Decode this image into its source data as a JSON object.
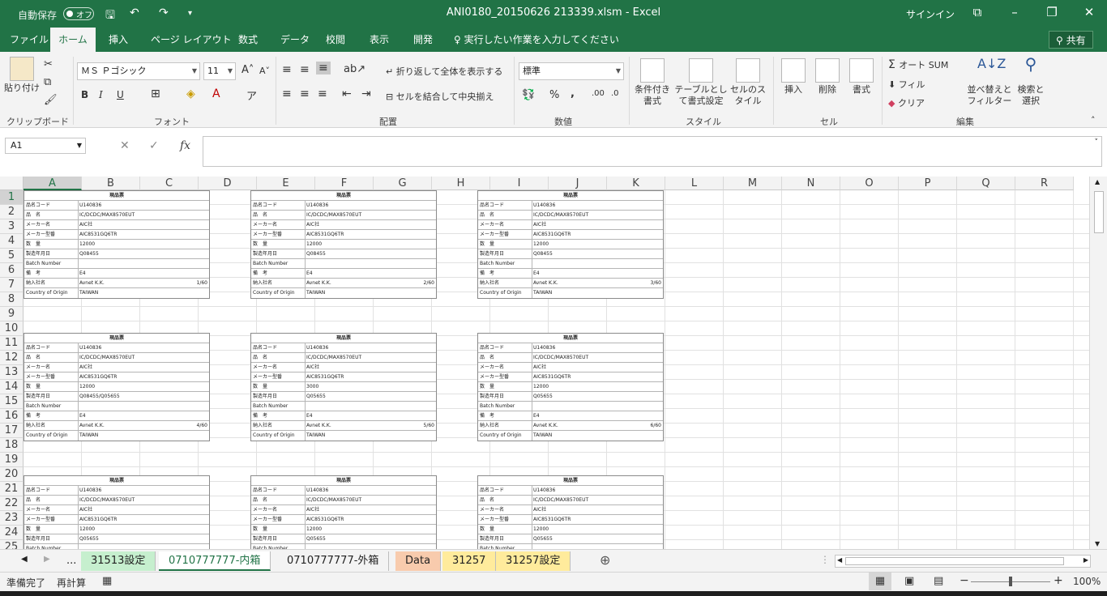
{
  "title_bar": {
    "autosave_label": "自動保存",
    "autosave_state": "オフ",
    "document_title": "ANI0180_20150626 213339.xlsm  -  Excel",
    "signin": "サインイン"
  },
  "ribbon_tabs": [
    "ファイル",
    "ホーム",
    "挿入",
    "ページ レイアウト",
    "数式",
    "データ",
    "校閲",
    "表示",
    "開発"
  ],
  "tell_me": "実行したい作業を入力してください",
  "share_label": "共有",
  "ribbon": {
    "clipboard": {
      "paste": "貼り付け",
      "label": "クリップボード"
    },
    "font": {
      "name": "ＭＳ Ｐゴシック",
      "size": "11",
      "bold": "B",
      "italic": "I",
      "underline": "U",
      "label": "フォント"
    },
    "alignment": {
      "wrap": "折り返して全体を表示する",
      "merge": "セルを結合して中央揃え",
      "label": "配置"
    },
    "number": {
      "format": "標準",
      "percent": "%",
      "comma": ",",
      "label": "数値"
    },
    "styles": {
      "conditional": "条件付き書式",
      "table": "テーブルとして書式設定",
      "cell": "セルのスタイル",
      "label": "スタイル"
    },
    "cells": {
      "insert": "挿入",
      "delete": "削除",
      "format": "書式",
      "label": "セル"
    },
    "editing": {
      "autosum": "オート SUM",
      "fill": "フィル",
      "clear": "クリア",
      "sort": "並べ替えとフィルター",
      "find": "検索と選択",
      "label": "編集"
    }
  },
  "formula_bar": {
    "name_box": "A1",
    "fx": "fx",
    "value": ""
  },
  "columns": [
    "A",
    "B",
    "C",
    "D",
    "E",
    "F",
    "G",
    "H",
    "I",
    "J",
    "K",
    "L",
    "M",
    "N",
    "O",
    "P",
    "Q",
    "R"
  ],
  "rows": [
    "1",
    "2",
    "3",
    "4",
    "5",
    "6",
    "7",
    "8",
    "9",
    "10",
    "11",
    "12",
    "13",
    "14",
    "15",
    "16",
    "17",
    "18",
    "19",
    "20",
    "21",
    "22",
    "23",
    "24",
    "25"
  ],
  "card_labels": {
    "title": "現品票",
    "code": "品名コード",
    "name": "品　名",
    "maker": "メーカー名",
    "model": "メーカー型番",
    "qty": "数　量",
    "date": "製造年月日",
    "batch": "Batch Number",
    "remarks": "備　考",
    "dest": "納入社名",
    "origin": "Country of Origin"
  },
  "cards": [
    {
      "code": "U140836",
      "name": "IC/DCDC/MAX8570EUT",
      "maker": "AIC社",
      "model": "AIC8531GQ6TR",
      "qty": "12000",
      "date": "Q08455",
      "batch": "",
      "remarks": "E4",
      "dest": "Avnet K.K.",
      "page": "1/60",
      "origin": "TAIWAN"
    },
    {
      "code": "U140836",
      "name": "IC/DCDC/MAX8570EUT",
      "maker": "AIC社",
      "model": "AIC8531GQ6TR",
      "qty": "12000",
      "date": "Q08455",
      "batch": "",
      "remarks": "E4",
      "dest": "Avnet K.K.",
      "page": "2/60",
      "origin": "TAIWAN"
    },
    {
      "code": "U140836",
      "name": "IC/DCDC/MAX8570EUT",
      "maker": "AIC社",
      "model": "AIC8531GQ6TR",
      "qty": "12000",
      "date": "Q08455",
      "batch": "",
      "remarks": "E4",
      "dest": "Avnet K.K.",
      "page": "3/60",
      "origin": "TAIWAN"
    },
    {
      "code": "U140836",
      "name": "IC/DCDC/MAX8570EUT",
      "maker": "AIC社",
      "model": "AIC8531GQ6TR",
      "qty": "12000",
      "date": "Q08455/Q05655",
      "batch": "",
      "remarks": "E4",
      "dest": "Avnet K.K.",
      "page": "4/60",
      "origin": "TAIWAN"
    },
    {
      "code": "U140836",
      "name": "IC/DCDC/MAX8570EUT",
      "maker": "AIC社",
      "model": "AIC8531GQ6TR",
      "qty": "3000",
      "date": "Q05655",
      "batch": "",
      "remarks": "E4",
      "dest": "Avnet K.K.",
      "page": "5/60",
      "origin": "TAIWAN"
    },
    {
      "code": "U140836",
      "name": "IC/DCDC/MAX8570EUT",
      "maker": "AIC社",
      "model": "AIC8531GQ6TR",
      "qty": "12000",
      "date": "Q05655",
      "batch": "",
      "remarks": "E4",
      "dest": "Avnet K.K.",
      "page": "6/60",
      "origin": "TAIWAN"
    },
    {
      "code": "U140836",
      "name": "IC/DCDC/MAX8570EUT",
      "maker": "AIC社",
      "model": "AIC8531GQ6TR",
      "qty": "12000",
      "date": "Q05655",
      "batch": "",
      "remarks": "",
      "dest": "",
      "page": "",
      "origin": ""
    },
    {
      "code": "U140836",
      "name": "IC/DCDC/MAX8570EUT",
      "maker": "AIC社",
      "model": "AIC8531GQ6TR",
      "qty": "12000",
      "date": "Q05655",
      "batch": "",
      "remarks": "",
      "dest": "",
      "page": "",
      "origin": ""
    },
    {
      "code": "U140836",
      "name": "IC/DCDC/MAX8570EUT",
      "maker": "AIC社",
      "model": "AIC8531GQ6TR",
      "qty": "12000",
      "date": "Q05655",
      "batch": "",
      "remarks": "",
      "dest": "",
      "page": "",
      "origin": ""
    }
  ],
  "sheet_tabs": [
    {
      "name": "...",
      "color": "#f3f3f3"
    },
    {
      "name": "31513設定",
      "color": "#c6efce"
    },
    {
      "name": "0710777777-内箱",
      "color": "#ffffff",
      "active": true
    },
    {
      "name": "0710777777-外箱",
      "color": "#f3f3f3"
    },
    {
      "name": "Data",
      "color": "#f8cbad"
    },
    {
      "name": "31257",
      "color": "#ffeb9c"
    },
    {
      "name": "31257設定",
      "color": "#ffeb9c"
    }
  ],
  "status": {
    "ready": "準備完了",
    "recalc": "再計算",
    "zoom": "100%"
  },
  "colors": {
    "accent": "#217346"
  }
}
